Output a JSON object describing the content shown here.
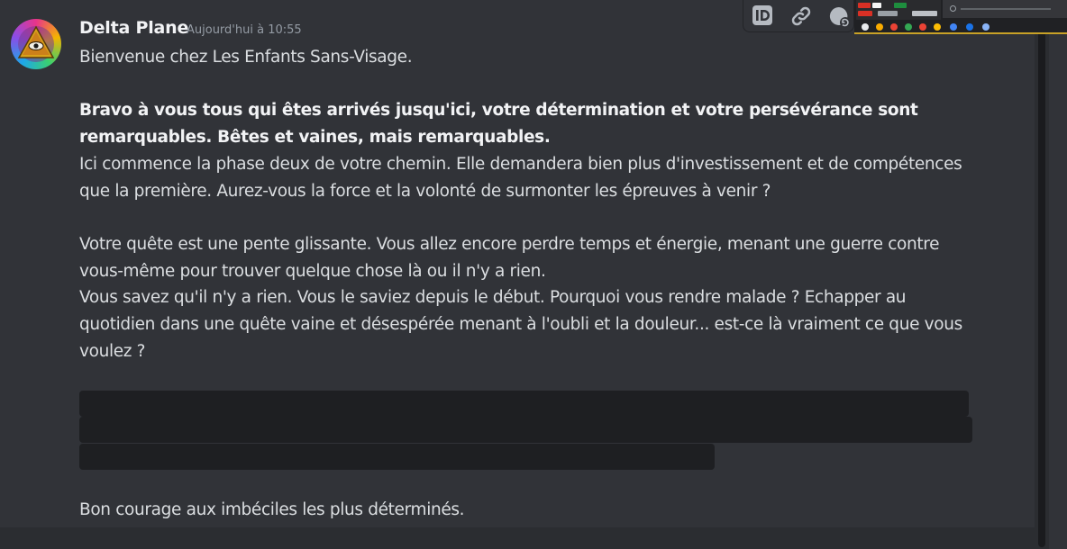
{
  "message": {
    "author": "Delta Plane",
    "timestamp": "Aujourd'hui à 10:55",
    "welcome": "Bienvenue chez Les Enfants Sans-Visage.",
    "bold_line_1": "Bravo à vous tous qui êtes arrivés jusqu'ici, votre détermination et votre persévérance sont",
    "bold_line_2": "remarquables. Bêtes et vaines, mais remarquables.",
    "para2": "Ici commence la phase deux de votre chemin. Elle demandera bien plus d'investissement et de compétences que la première. Aurez-vous la force et la volonté de surmonter les épreuves à venir ?",
    "para3a": "Votre quête est une pente glissante. Vous allez encore perdre temps et énergie, menant une guerre contre vous-même pour trouver quelque chose là ou il n'y a rien.",
    "para3b": "Vous savez qu'il n'y a rien. Vous le saviez depuis le début. Pourquoi vous rendre malade ? Echapper au quotidien dans une quête vaine et désespérée menant à l'oubli et la douleur... est-ce là vraiment ce que vous voulez ?",
    "closing": "Bon courage aux imbéciles les plus déterminés."
  },
  "toolbar": {
    "icons": [
      "id-icon",
      "link-icon",
      "thread-icon"
    ]
  },
  "theme": {
    "background": "#313338",
    "text": "#dbdee1",
    "muted": "#949ba4",
    "spoiler": "#1e1f22"
  }
}
